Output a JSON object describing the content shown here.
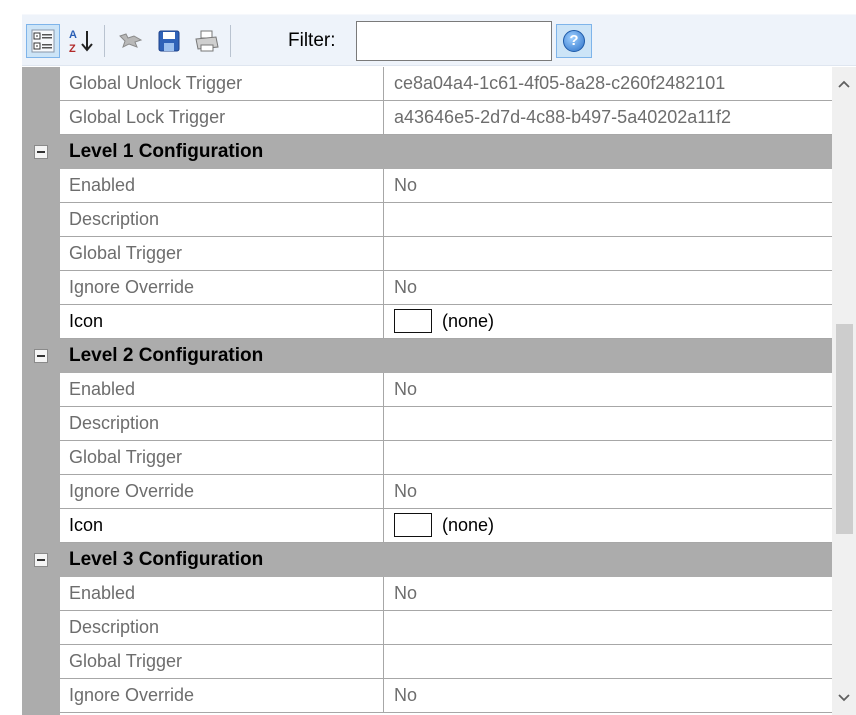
{
  "toolbar": {
    "filter_label": "Filter:",
    "filter_value": "",
    "help_glyph": "?",
    "icons": [
      "categorized-icon",
      "alphabetical-icon",
      "delete-icon",
      "save-icon",
      "print-icon",
      "help-icon"
    ]
  },
  "rows": [
    {
      "type": "prop",
      "name": "Global Unlock Trigger",
      "value": "ce8a04a4-1c61-4f05-8a28-c260f2482101"
    },
    {
      "type": "prop",
      "name": "Global Lock Trigger",
      "value": "a43646e5-2d7d-4c88-b497-5a40202a11f2"
    },
    {
      "type": "category",
      "name": "Level 1 Configuration"
    },
    {
      "type": "prop",
      "name": "Enabled",
      "value": "No"
    },
    {
      "type": "prop",
      "name": "Description",
      "value": ""
    },
    {
      "type": "prop",
      "name": "Global Trigger",
      "value": ""
    },
    {
      "type": "prop",
      "name": "Ignore Override",
      "value": "No"
    },
    {
      "type": "icon",
      "name": "Icon",
      "value": "(none)"
    },
    {
      "type": "category",
      "name": "Level 2 Configuration"
    },
    {
      "type": "prop",
      "name": "Enabled",
      "value": "No"
    },
    {
      "type": "prop",
      "name": "Description",
      "value": ""
    },
    {
      "type": "prop",
      "name": "Global Trigger",
      "value": ""
    },
    {
      "type": "prop",
      "name": "Ignore Override",
      "value": "No"
    },
    {
      "type": "icon",
      "name": "Icon",
      "value": "(none)"
    },
    {
      "type": "category",
      "name": "Level 3 Configuration"
    },
    {
      "type": "prop",
      "name": "Enabled",
      "value": "No"
    },
    {
      "type": "prop",
      "name": "Description",
      "value": ""
    },
    {
      "type": "prop",
      "name": "Global Trigger",
      "value": ""
    },
    {
      "type": "prop",
      "name": "Ignore Override",
      "value": "No"
    }
  ],
  "colors": {
    "category_bg": "#acacac",
    "toolbar_bg": "#eef3fa",
    "readonly_text": "#6d6d6d",
    "selected_button": "#cce4f7"
  }
}
